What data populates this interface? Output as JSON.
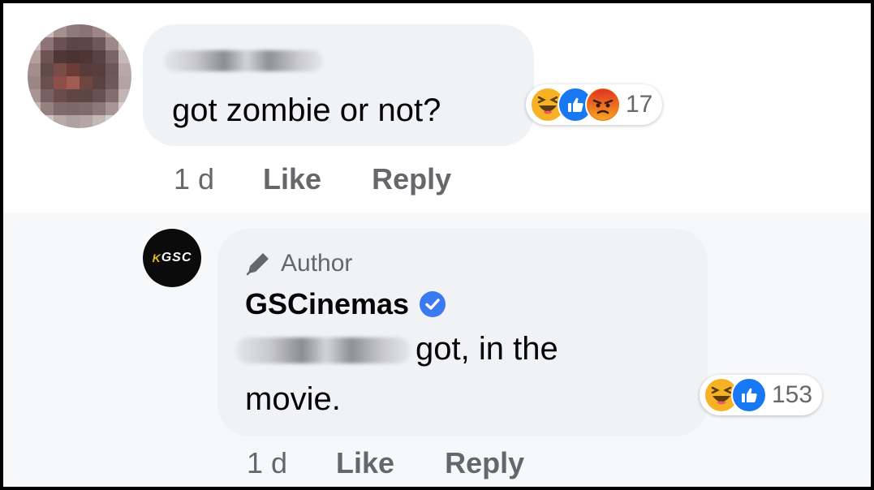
{
  "colors": {
    "bubble": "#f0f2f5",
    "secondary_text": "#65676b",
    "primary_text": "#050505",
    "like_blue": "#1877f2",
    "verified_blue": "#3b79f2",
    "haha_yellow": "#f7b125",
    "angry_orange": "#e9710f",
    "gsc_gold": "#e5b91c"
  },
  "comment": {
    "avatar": "pixelated-avatar",
    "author": "",
    "text": "got zombie or not?",
    "reactions": {
      "icons": [
        "haha-icon",
        "like-icon",
        "angry-icon"
      ],
      "count": "17"
    },
    "actions": {
      "time": "1 d",
      "like": "Like",
      "reply": "Reply"
    }
  },
  "reply": {
    "avatar": {
      "mark": "K",
      "text": "GSC"
    },
    "badge": "Author",
    "author": "GSCinemas",
    "verified": true,
    "mention": "",
    "text_line1": "got, in the",
    "text_line2": "movie.",
    "reactions": {
      "icons": [
        "haha-icon",
        "like-icon"
      ],
      "count": "153"
    },
    "actions": {
      "time": "1 d",
      "like": "Like",
      "reply": "Reply"
    }
  }
}
